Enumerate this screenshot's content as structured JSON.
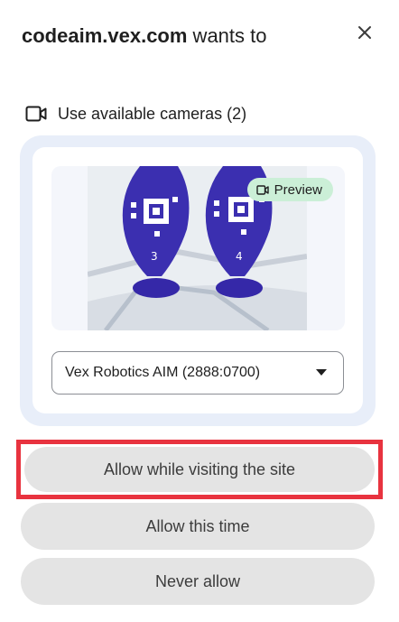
{
  "dialog": {
    "origin": "codeaim.vex.com",
    "title_suffix": " wants to",
    "close_icon": "close-icon"
  },
  "permission": {
    "icon": "video-camera-icon",
    "label": "Use available cameras (2)"
  },
  "camera": {
    "preview_chip_icon": "video-camera-icon",
    "preview_label": "Preview",
    "image": "camera-preview-image",
    "selected_device": "Vex Robotics AIM (2888:0700)",
    "dropdown_icon": "dropdown-arrow-icon"
  },
  "buttons": {
    "allow_while_visiting": "Allow while visiting the site",
    "allow_this_time": "Allow this time",
    "never_allow": "Never allow"
  },
  "colors": {
    "panel_bg": "#e8eef9",
    "chip_bg": "#cbefd7",
    "button_bg": "#e4e4e4",
    "highlight": "#e8333f"
  }
}
